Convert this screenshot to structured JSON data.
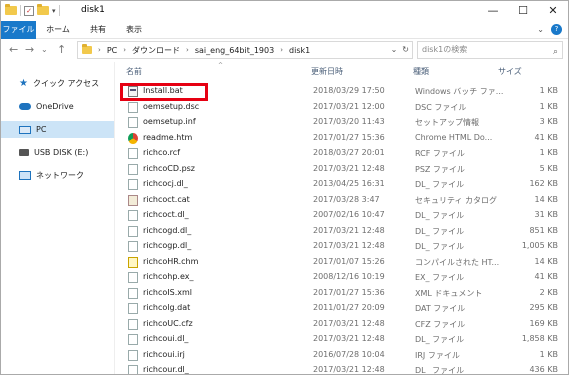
{
  "window": {
    "title": "disk1",
    "minimize_glyph": "—",
    "maximize_glyph": "☐",
    "close_glyph": "✕"
  },
  "ribbon": {
    "tabs": [
      "ファイル",
      "ホーム",
      "共有",
      "表示"
    ]
  },
  "address": {
    "path": [
      "PC",
      "ダウンロード",
      "sai_eng_64bit_1903",
      "disk1"
    ],
    "search_placeholder": "disk1の検索"
  },
  "navigation": {
    "items": [
      "クイック アクセス",
      "OneDrive",
      "PC",
      "USB DISK (E:)",
      "ネットワーク"
    ],
    "selected": "PC"
  },
  "file_list": {
    "columns": [
      "名前",
      "更新日時",
      "種類",
      "サイズ"
    ],
    "rows": [
      {
        "icon": "batch-file-icon",
        "name": "Install.bat",
        "date": "2018/03/29 17:50",
        "type": "Windows バッチ ファ...",
        "size": "1 KB"
      },
      {
        "icon": "document-icon",
        "name": "oemsetup.dsc",
        "date": "2017/03/21 12:00",
        "type": "DSC ファイル",
        "size": "1 KB"
      },
      {
        "icon": "document-icon",
        "name": "oemsetup.inf",
        "date": "2017/03/20 11:43",
        "type": "セットアップ情報",
        "size": "3 KB"
      },
      {
        "icon": "chrome-icon",
        "name": "readme.htm",
        "date": "2017/01/27 15:36",
        "type": "Chrome HTML Do...",
        "size": "41 KB"
      },
      {
        "icon": "document-icon",
        "name": "richco.rcf",
        "date": "2018/03/27 20:01",
        "type": "RCF ファイル",
        "size": "1 KB"
      },
      {
        "icon": "document-icon",
        "name": "richcoCD.psz",
        "date": "2017/03/21 12:48",
        "type": "PSZ ファイル",
        "size": "5 KB"
      },
      {
        "icon": "document-icon",
        "name": "richcocj.dl_",
        "date": "2013/04/25 16:31",
        "type": "DL_ ファイル",
        "size": "162 KB"
      },
      {
        "icon": "catalog-icon",
        "name": "richcoct.cat",
        "date": "2017/03/28 3:47",
        "type": "セキュリティ カタログ",
        "size": "14 KB"
      },
      {
        "icon": "document-icon",
        "name": "richcoct.dl_",
        "date": "2007/02/16 10:47",
        "type": "DL_ ファイル",
        "size": "31 KB"
      },
      {
        "icon": "document-icon",
        "name": "richcogd.dl_",
        "date": "2017/03/21 12:48",
        "type": "DL_ ファイル",
        "size": "851 KB"
      },
      {
        "icon": "document-icon",
        "name": "richcogp.dl_",
        "date": "2017/03/21 12:48",
        "type": "DL_ ファイル",
        "size": "1,005 KB"
      },
      {
        "icon": "chm-icon",
        "name": "richcoHR.chm",
        "date": "2017/01/07 15:26",
        "type": "コンパイルされた HT...",
        "size": "14 KB"
      },
      {
        "icon": "document-icon",
        "name": "richcohp.ex_",
        "date": "2008/12/16 10:19",
        "type": "EX_ ファイル",
        "size": "41 KB"
      },
      {
        "icon": "document-icon",
        "name": "richcoIS.xml",
        "date": "2017/01/27 15:36",
        "type": "XML ドキュメント",
        "size": "2 KB"
      },
      {
        "icon": "document-icon",
        "name": "richcolg.dat",
        "date": "2011/01/27 20:09",
        "type": "DAT ファイル",
        "size": "295 KB"
      },
      {
        "icon": "document-icon",
        "name": "richcoUC.cfz",
        "date": "2017/03/21 12:48",
        "type": "CFZ ファイル",
        "size": "169 KB"
      },
      {
        "icon": "document-icon",
        "name": "richcoui.dl_",
        "date": "2017/03/21 12:48",
        "type": "DL_ ファイル",
        "size": "1,858 KB"
      },
      {
        "icon": "document-icon",
        "name": "richcoui.irj",
        "date": "2016/07/28 10:04",
        "type": "IRJ ファイル",
        "size": "1 KB"
      },
      {
        "icon": "document-icon",
        "name": "richcour.dl_",
        "date": "2017/03/21 12:48",
        "type": "DL_ ファイル",
        "size": "436 KB"
      }
    ]
  },
  "colors": {
    "accent": "#1979ca",
    "selection": "#cce4f7",
    "highlight_box": "#e60012"
  }
}
